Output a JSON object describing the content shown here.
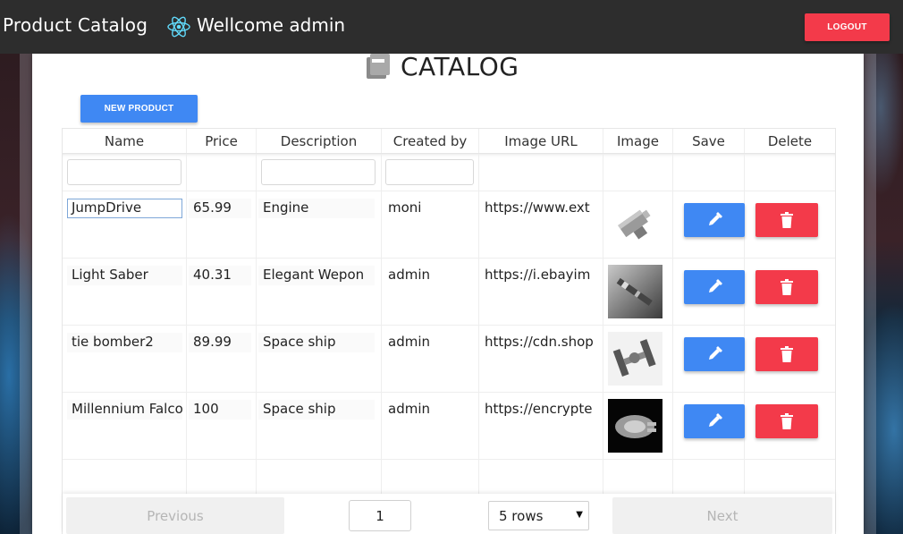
{
  "navbar": {
    "brand": "Product Catalog",
    "welcome": "Wellcome admin",
    "logout_label": "LOGOUT"
  },
  "catalog": {
    "title": "CATALOG",
    "new_product_label": "NEW PRODUCT"
  },
  "table": {
    "headers": [
      "Name",
      "Price",
      "Description",
      "Created by",
      "Image URL",
      "Image",
      "Save",
      "Delete"
    ],
    "rows": [
      {
        "name": "JumpDrive",
        "price": "65.99",
        "description": "Engine",
        "created_by": "moni",
        "image_url": "https://www.ext"
      },
      {
        "name": "Light Saber",
        "price": "40.31",
        "description": "Elegant Wepon",
        "created_by": "admin",
        "image_url": "https://i.ebayim"
      },
      {
        "name": "tie bomber2",
        "price": "89.99",
        "description": "Space ship",
        "created_by": "admin",
        "image_url": "https://cdn.shop"
      },
      {
        "name": "Millennium Falco",
        "price": "100",
        "description": "Space ship",
        "created_by": "admin",
        "image_url": "https://encrypte"
      }
    ]
  },
  "pagination": {
    "previous_label": "Previous",
    "next_label": "Next",
    "page": "1",
    "rows_option": "5 rows"
  },
  "colors": {
    "primary": "#3f88f3",
    "danger": "#f33a4a",
    "navbar": "#2d2d2d"
  },
  "icons": {
    "react": "react-logo-icon",
    "catalog": "catalog-icon",
    "edit": "pencil-icon",
    "delete": "trash-icon"
  }
}
